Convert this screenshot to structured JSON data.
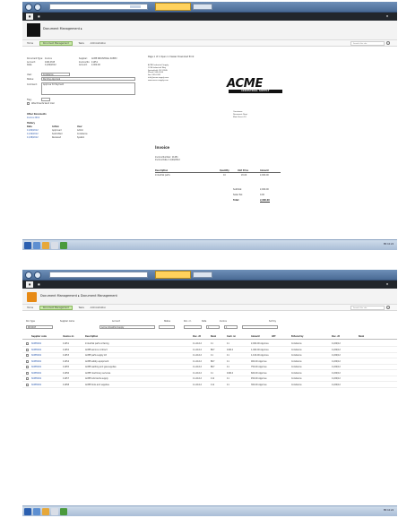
{
  "top": {
    "browser": {
      "tab_label": "Document"
    },
    "app_title": "Document Management ▸",
    "nav_tabs": [
      "Home",
      "Document Management",
      "Tasks",
      "Administration"
    ],
    "selected_tab_index": 1,
    "search_placeholder": "Search this site",
    "fields": [
      {
        "label": "Document Type:",
        "value": "Invoice"
      },
      {
        "label": "Account:",
        "value": "10012345"
      },
      {
        "label": "Supplier:",
        "value": "ACME INDUSTRIAL SUPPLY"
      },
      {
        "label": "Invoice No:",
        "value": "11451"
      },
      {
        "label": "Date:",
        "value": "11/20/2012"
      },
      {
        "label": "Amount:",
        "value": "2,000.00"
      }
    ],
    "form": {
      "user_label": "User:",
      "user_value": "Constance",
      "status_label": "Status:",
      "status_value": "Pending Approval",
      "comment_label": "Comment:",
      "comment_value": "Approve for Payment",
      "flag_label": "Flag:",
      "flag_value": "Approve",
      "checkbox_label": "Attachments Send mail"
    },
    "sections": {
      "links_title": "Other Documents",
      "links": [
        "Invoice 2012"
      ],
      "history_title": "History",
      "history_headers": [
        "Date",
        "Action",
        "User"
      ],
      "history_rows": [
        [
          "11/20/2012",
          "Approved",
          "Admin"
        ],
        [
          "11/19/2012",
          "Submitted",
          "Constance"
        ],
        [
          "11/18/2012",
          "Received",
          "System"
        ]
      ]
    },
    "doc": {
      "toolbar_text": "Page 1 of 1    Open in Viewer    Download    Print",
      "brand": "ACME",
      "brand_sub": "INDUSTRIAL SUPPLY",
      "invoice_title": "Invoice",
      "bill_lines": [
        "ACME Industrial Supply",
        "1234 Industrial Way",
        "Springfield, US 12345",
        "Phone: 555-0100",
        "Fax: 555-0101",
        "info@acme-supply.com",
        "www.acme-supply.com"
      ],
      "ship_lines": [
        "Constance",
        "Document Dept.",
        "Main Street 10"
      ],
      "meta_lines": [
        "Invoice Number: 11451",
        "Invoice Date: 11/20/2012"
      ],
      "line_headers": [
        "Description",
        "Quantity",
        "Unit Price",
        "Amount"
      ],
      "line_rows": [
        [
          "Industrial parts",
          "10",
          "20.00",
          "2,000.00"
        ]
      ],
      "totals": [
        [
          "Subtotal:",
          "2,000.00"
        ],
        [
          "Sales Tax:",
          "0.00"
        ],
        [
          "Total:",
          "2,000.00"
        ]
      ]
    },
    "taskbar": {
      "tray_text": "EN  10:24"
    }
  },
  "bottom": {
    "browser": {
      "tab_label": "Document"
    },
    "app_title": "Document Management ▸ Document Management",
    "nav_tabs": [
      "Home",
      "Document Management",
      "Tasks",
      "Administration"
    ],
    "selected_tab_index": 1,
    "search_placeholder": "Search this site",
    "filters": [
      "Doc type",
      "Supplier name",
      "Account",
      "Status",
      "Doc. nr.",
      "Date",
      "Invoice",
      "Sort by"
    ],
    "filter_values": [
      "INVOICE",
      "Acme Industrial Supply",
      "1",
      "1"
    ],
    "headers": [
      "Supplier code",
      "Invoice nr.",
      "Description",
      "Doc. dt",
      "Book",
      "Cust. nr.",
      "Amount",
      "VAT",
      "Entered by",
      "Doc. dt",
      "Book"
    ],
    "rows": [
      [
        "SUPP0001",
        "11451",
        "Industrial parts ordering",
        "11-20-12",
        "11",
        "11",
        "2,000.00  Approve",
        "Constance",
        "11/20/12"
      ],
      [
        "SUPP0001",
        "11452",
        "ACME service contract",
        "11-20-12",
        "BUY",
        "10012",
        "1,400.00  Approve",
        "Constance",
        "11/20/12"
      ],
      [
        "SUPP0001",
        "11453",
        "ACME parts supply kit",
        "11-20-12",
        "11",
        "11",
        "1,100.00  Approve",
        "Constance",
        "11/20/12"
      ],
      [
        "SUPP0001",
        "11454",
        "ACME safety equipment",
        "11-20-12",
        "BUY",
        "11",
        "900.00  Approve",
        "Constance",
        "11/20/12"
      ],
      [
        "SUPP0001",
        "11455",
        "ACME welding and gas supplies",
        "11-20-12",
        "BUY",
        "11",
        "750.00  Approve",
        "Constance",
        "11/20/12"
      ],
      [
        "SUPP0001",
        "11456",
        "ACME machinery services",
        "11-20-12",
        "11",
        "10012",
        "600.00  Approve",
        "Constance",
        "11/20/12"
      ],
      [
        "SUPP0001",
        "11457",
        "ACME lubricants supply",
        "11-20-12",
        "111",
        "11",
        "450.00  Approve",
        "Constance",
        "11/20/12"
      ],
      [
        "SUPP0001",
        "11458",
        "ACME tools and supplies",
        "11-20-12",
        "111",
        "11",
        "300.00  Approve",
        "Constance",
        "11/20/12"
      ]
    ],
    "taskbar": {
      "tray_text": "EN  10:24"
    }
  }
}
